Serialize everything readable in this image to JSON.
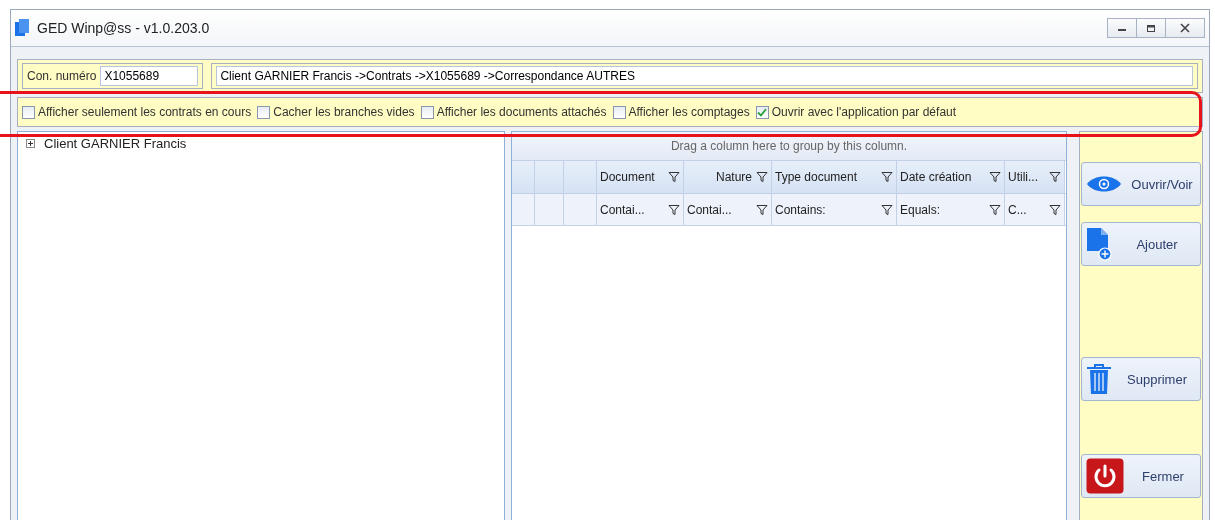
{
  "window": {
    "title": "GED Winp@ss  - v1.0.203.0"
  },
  "contract": {
    "label": "Con. numéro",
    "value": "X1055689"
  },
  "breadcrumb": {
    "value": "Client GARNIER Francis ->Contrats ->X1055689 ->Correspondance AUTRES"
  },
  "options": [
    {
      "label": "Afficher seulement les contrats en cours",
      "checked": false
    },
    {
      "label": "Cacher les branches vides",
      "checked": false
    },
    {
      "label": "Afficher les documents attachés",
      "checked": false
    },
    {
      "label": "Afficher les comptages",
      "checked": false
    },
    {
      "label": "Ouvrir avec l'application par défaut",
      "checked": true
    }
  ],
  "tree": [
    {
      "label": "Client GARNIER Francis",
      "expanded": false
    }
  ],
  "grid": {
    "group_hint": "Drag a column here to group by this column.",
    "columns": [
      {
        "header": "Document",
        "filter": "Contai..."
      },
      {
        "header": "Nature",
        "filter": "Contai..."
      },
      {
        "header": "Type document",
        "filter": "Contains:"
      },
      {
        "header": "Date création",
        "filter": "Equals:"
      },
      {
        "header": "Utili...",
        "filter": "C..."
      }
    ]
  },
  "actions": [
    {
      "label": "Ouvrir/Voir",
      "kind": "view"
    },
    {
      "label": "Ajouter",
      "kind": "add"
    },
    {
      "label": "Supprimer",
      "kind": "delete"
    },
    {
      "label": "Fermer",
      "kind": "close"
    }
  ]
}
